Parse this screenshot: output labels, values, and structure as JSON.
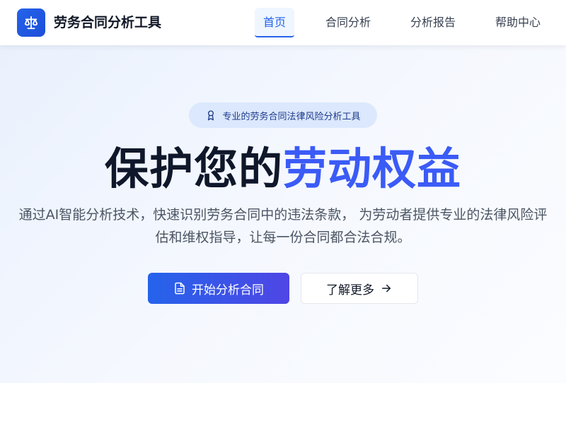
{
  "header": {
    "app_title": "劳务合同分析工具",
    "logo_icon": "scale-icon",
    "nav": [
      {
        "label": "首页",
        "active": true
      },
      {
        "label": "合同分析",
        "active": false
      },
      {
        "label": "分析报告",
        "active": false
      },
      {
        "label": "帮助中心",
        "active": false
      }
    ]
  },
  "hero": {
    "badge": {
      "icon": "award-icon",
      "text": "专业的劳务合同法律风险分析工具"
    },
    "headline": {
      "prefix": "保护您的",
      "highlight": "劳动权益"
    },
    "subtitle": "通过AI智能分析技术，快速识别劳务合同中的违法条款， 为劳动者提供专业的法律风险评估和维权指导，让每一份合同都合法合规。",
    "primary_button": {
      "icon": "document-icon",
      "label": "开始分析合同"
    },
    "secondary_button": {
      "label": "了解更多",
      "icon": "arrow-right-icon"
    }
  },
  "colors": {
    "accent": "#2563eb",
    "headline_highlight": "#3b5bf6",
    "badge_bg": "#dbe8fd",
    "hero_bg": "#eaf1fd"
  }
}
